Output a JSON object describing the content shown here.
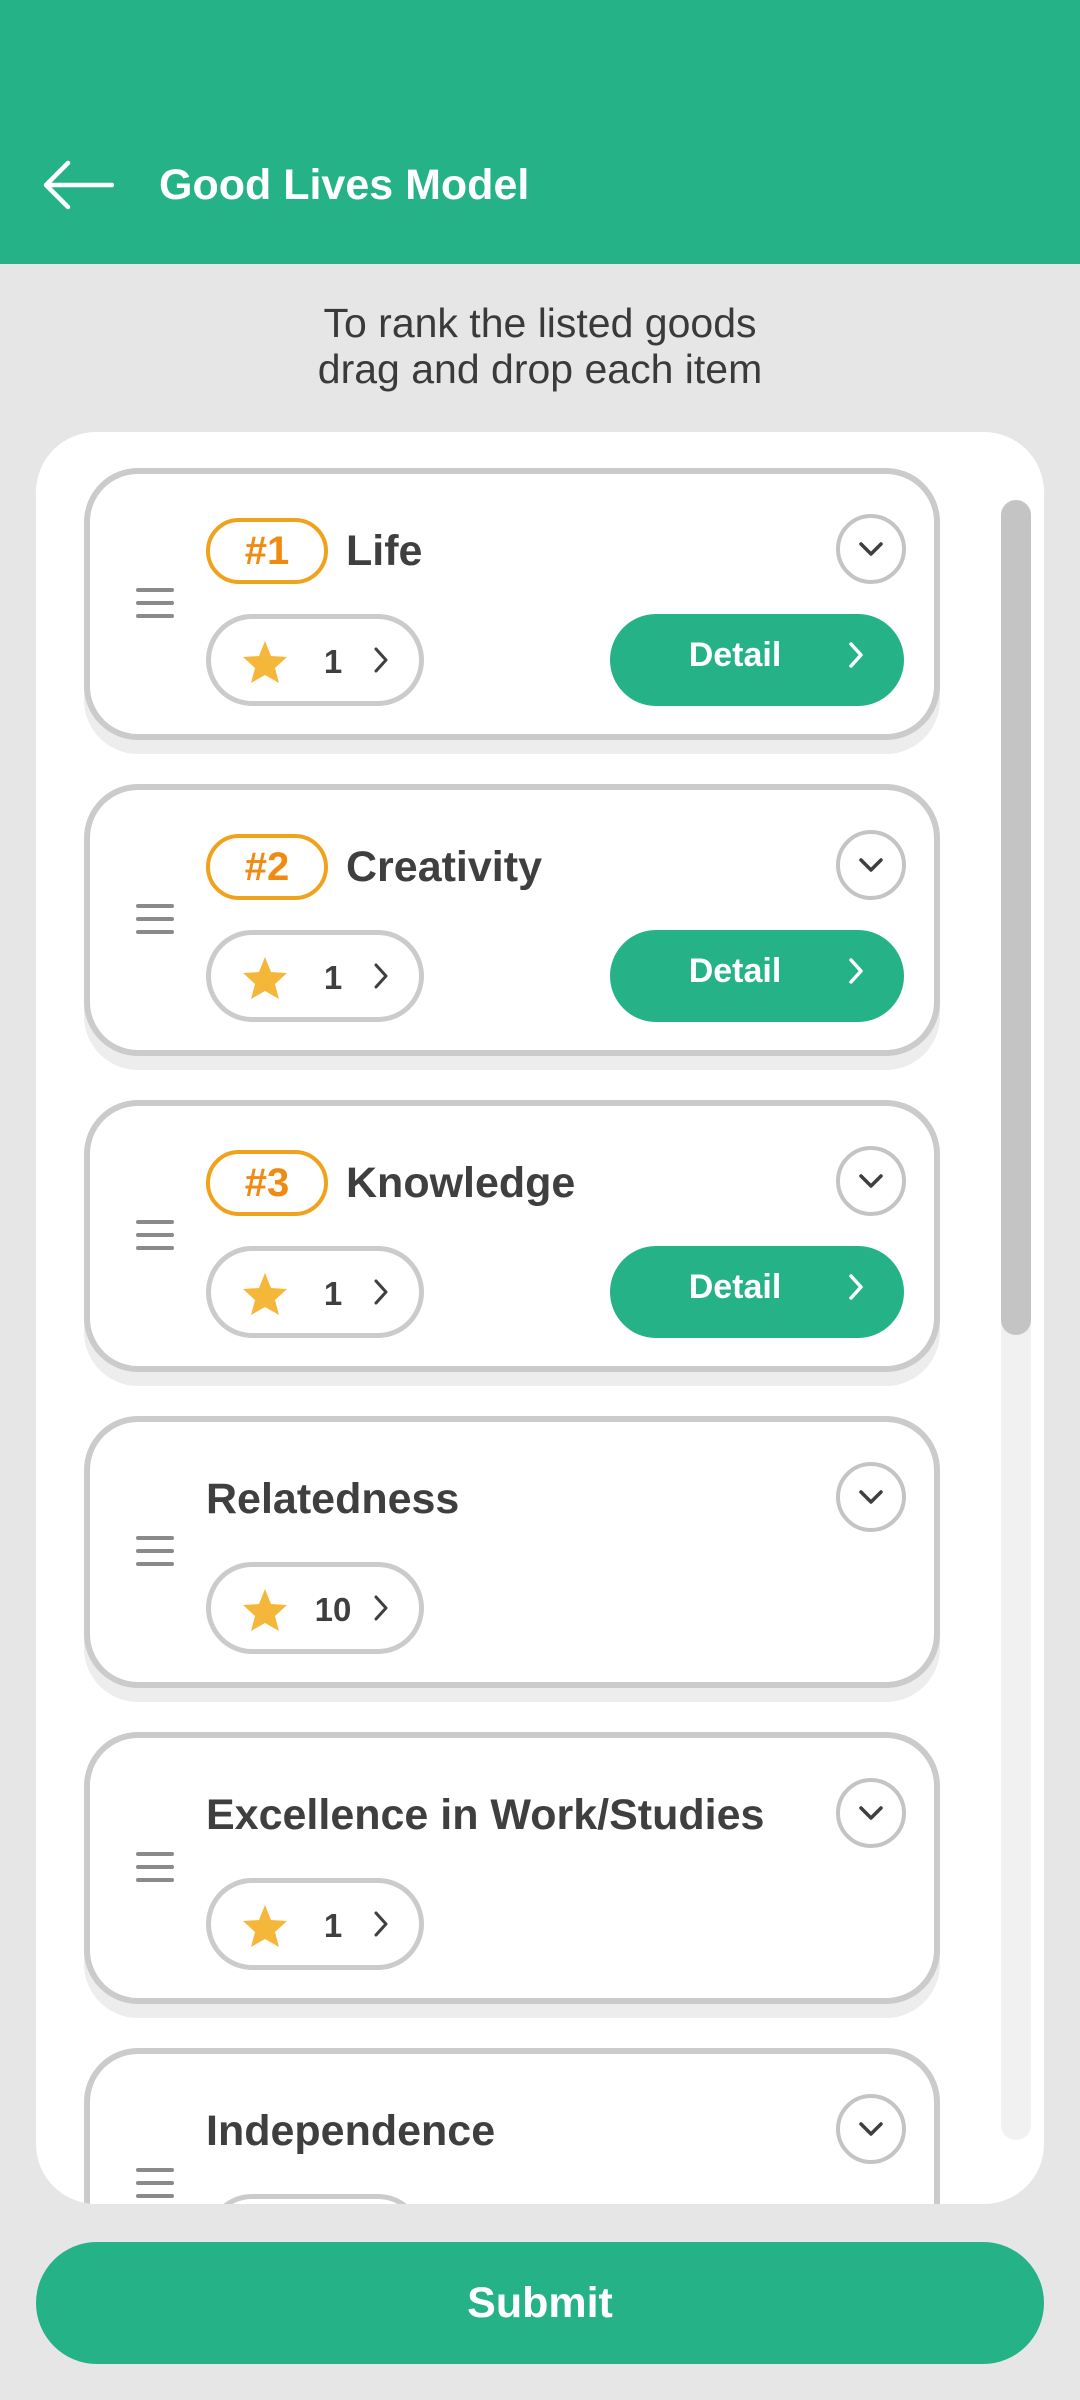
{
  "app": {
    "title": "Good Lives Model"
  },
  "instruction": {
    "line1": "To rank the listed goods",
    "line2": "drag and drop each item"
  },
  "colors": {
    "primary": "#24b286",
    "rank_accent": "#ef8a12",
    "star": "#f5b73a"
  },
  "items": [
    {
      "rank": "#1",
      "name": "Life",
      "rating": "1",
      "detail_label": "Detail"
    },
    {
      "rank": "#2",
      "name": "Creativity",
      "rating": "1",
      "detail_label": "Detail"
    },
    {
      "rank": "#3",
      "name": "Knowledge",
      "rating": "1",
      "detail_label": "Detail"
    },
    {
      "name": "Relatedness",
      "rating": "10"
    },
    {
      "name": "Excellence in Work/Studies",
      "rating": "1"
    },
    {
      "name": "Independence"
    }
  ],
  "submit_label": "Submit",
  "icons": {
    "back": "arrow-left-icon",
    "handle": "drag-handle-icon",
    "expand": "chevron-down-icon",
    "rating": "star-icon",
    "next": "chevron-right-icon"
  }
}
